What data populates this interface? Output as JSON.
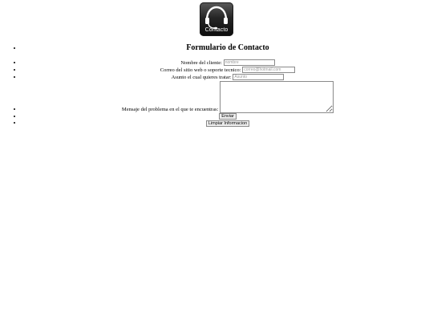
{
  "logo": {
    "text": "Contacto",
    "icon": "headset-icon"
  },
  "form": {
    "title": "Formulario de Contacto",
    "fields": {
      "name_label": "Nombre del cliente:",
      "name_placeholder": "nombre",
      "email_label": "Correo del sitio web o soporte tecnico:",
      "email_placeholder": "correo@hotmail.com",
      "subject_label": "Asunto el cual quieres tratar:",
      "subject_placeholder": "Asunto",
      "message_label": "Mensaje del problema en el que te encuentras:"
    },
    "buttons": {
      "submit_label": "Enviar",
      "reset_label": "Limpiar Informacion"
    }
  }
}
